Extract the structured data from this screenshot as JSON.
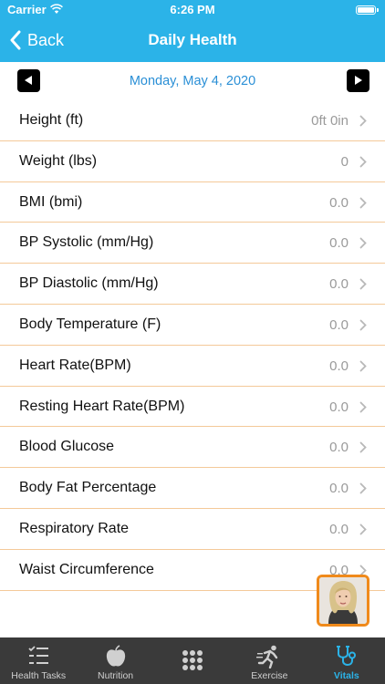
{
  "status_bar": {
    "carrier": "Carrier",
    "time": "6:26 PM"
  },
  "nav": {
    "back_label": "Back",
    "title": "Daily Health"
  },
  "date_bar": {
    "date": "Monday, May 4, 2020"
  },
  "vitals": [
    {
      "label": "Height (ft)",
      "value": "0ft 0in"
    },
    {
      "label": "Weight (lbs)",
      "value": "0"
    },
    {
      "label": "BMI (bmi)",
      "value": "0.0"
    },
    {
      "label": "BP Systolic (mm/Hg)",
      "value": "0.0"
    },
    {
      "label": "BP Diastolic (mm/Hg)",
      "value": "0.0"
    },
    {
      "label": "Body Temperature (F)",
      "value": "0.0"
    },
    {
      "label": "Heart Rate(BPM)",
      "value": "0.0"
    },
    {
      "label": "Resting Heart Rate(BPM)",
      "value": "0.0"
    },
    {
      "label": "Blood Glucose",
      "value": "0.0"
    },
    {
      "label": "Body Fat Percentage",
      "value": "0.0"
    },
    {
      "label": "Respiratory Rate",
      "value": "0.0"
    },
    {
      "label": "Waist Circumference",
      "value": "0.0"
    }
  ],
  "tab_bar": {
    "tabs": [
      {
        "label": "Health Tasks",
        "icon": "task-list-icon"
      },
      {
        "label": "Nutrition",
        "icon": "apple-icon"
      },
      {
        "label": "",
        "icon": "grid-icon"
      },
      {
        "label": "Exercise",
        "icon": "runner-icon"
      },
      {
        "label": "Vitals",
        "icon": "stethoscope-icon"
      }
    ],
    "active_tab": "Vitals"
  },
  "colors": {
    "header": "#2bb3e8",
    "date_text": "#2a8fd6",
    "row_divider": "#f4c999",
    "avatar_border": "#f08a1b",
    "tab_bar": "#3a3a3a",
    "tab_active": "#2bb3e8"
  }
}
